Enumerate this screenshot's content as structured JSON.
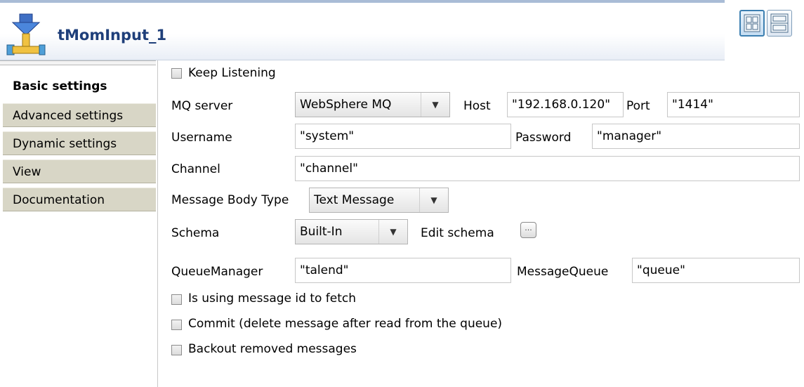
{
  "header": {
    "title": "tMomInput_1",
    "icon": "component-pipe-icon"
  },
  "sidebar": {
    "tabs": [
      {
        "label": "Basic settings",
        "selected": true
      },
      {
        "label": "Advanced settings"
      },
      {
        "label": "Dynamic settings"
      },
      {
        "label": "View"
      },
      {
        "label": "Documentation"
      }
    ]
  },
  "form": {
    "keep_listening": {
      "label": "Keep Listening",
      "checked": false
    },
    "mq_server": {
      "label": "MQ server",
      "value": "WebSphere MQ"
    },
    "host": {
      "label": "Host",
      "value": "\"192.168.0.120\""
    },
    "port": {
      "label": "Port",
      "value": "\"1414\""
    },
    "username": {
      "label": "Username",
      "value": "\"system\""
    },
    "password": {
      "label": "Password",
      "value": "\"manager\""
    },
    "channel": {
      "label": "Channel",
      "value": "\"channel\""
    },
    "message_body_type": {
      "label": "Message Body Type",
      "value": "Text Message"
    },
    "schema": {
      "label": "Schema",
      "value": "Built-In"
    },
    "edit_schema": {
      "label": "Edit schema",
      "button": "..."
    },
    "queue_manager": {
      "label": "QueueManager",
      "value": "\"talend\""
    },
    "message_queue": {
      "label": "MessageQueue",
      "value": "\"queue\""
    },
    "use_message_id": {
      "label": "Is using message id to fetch",
      "checked": false
    },
    "commit": {
      "label": "Commit (delete message after read from the queue)",
      "checked": false
    },
    "backout": {
      "label": "Backout removed messages",
      "checked": false
    }
  }
}
